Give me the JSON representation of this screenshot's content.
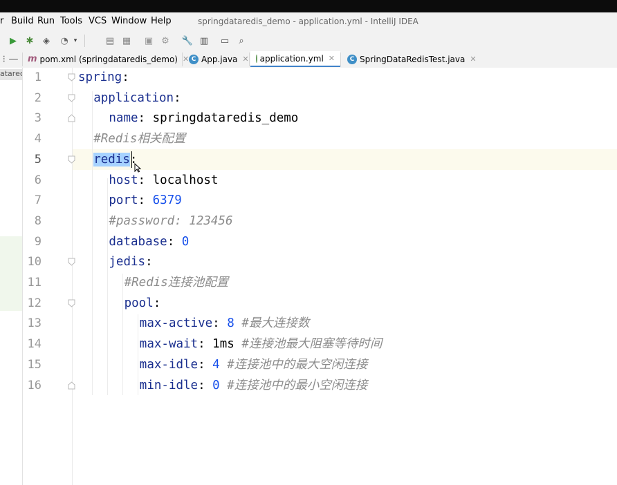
{
  "window": {
    "title": "springdataredis_demo - application.yml - IntelliJ IDEA"
  },
  "menu": [
    "r",
    "Build",
    "Run",
    "Tools",
    "VCS",
    "Window",
    "Help"
  ],
  "toolbar": {
    "icons": [
      "run-icon",
      "debug-icon",
      "coverage-icon",
      "profile-icon",
      "dropdown-icon",
      "build-icon",
      "project-structure-icon",
      "sdk-icon",
      "plugin-icon",
      "settings-wrench-icon",
      "structure-icon",
      "terminal-icon",
      "search-icon"
    ]
  },
  "tabs": [
    {
      "label": "pom.xml (springdataredis_demo)",
      "icon": "maven-icon",
      "icon_text": "m",
      "active": false
    },
    {
      "label": "App.java",
      "icon": "java-class-icon",
      "icon_text": "C",
      "active": false
    },
    {
      "label": "application.yml",
      "icon": "yaml-icon",
      "icon_text": "",
      "active": true
    },
    {
      "label": "SpringDataRedisTest.java",
      "icon": "java-class-icon",
      "icon_text": "C",
      "active": false
    }
  ],
  "side_label": "atarec",
  "editor": {
    "current_line": 5,
    "lines": [
      {
        "no": "1",
        "indent": 0,
        "parts": [
          {
            "t": "k",
            "s": "spring"
          },
          {
            "t": "v",
            "s": ":"
          }
        ]
      },
      {
        "no": "2",
        "indent": 1,
        "parts": [
          {
            "t": "k",
            "s": "application"
          },
          {
            "t": "v",
            "s": ":"
          }
        ]
      },
      {
        "no": "3",
        "indent": 2,
        "parts": [
          {
            "t": "k",
            "s": "name"
          },
          {
            "t": "v",
            "s": ": springdataredis_demo"
          }
        ]
      },
      {
        "no": "4",
        "indent": 1,
        "parts": [
          {
            "t": "c",
            "s": "#Redis相关配置"
          }
        ]
      },
      {
        "no": "5",
        "indent": 1,
        "parts": [
          {
            "t": "hl",
            "s": "redis"
          },
          {
            "t": "v",
            "s": ":"
          }
        ]
      },
      {
        "no": "6",
        "indent": 2,
        "parts": [
          {
            "t": "k",
            "s": "host"
          },
          {
            "t": "v",
            "s": ": localhost"
          }
        ]
      },
      {
        "no": "7",
        "indent": 2,
        "parts": [
          {
            "t": "k",
            "s": "port"
          },
          {
            "t": "v",
            "s": ": "
          },
          {
            "t": "n",
            "s": "6379"
          }
        ]
      },
      {
        "no": "8",
        "indent": 2,
        "parts": [
          {
            "t": "c",
            "s": "#password: 123456"
          }
        ]
      },
      {
        "no": "9",
        "indent": 2,
        "parts": [
          {
            "t": "k",
            "s": "database"
          },
          {
            "t": "v",
            "s": ": "
          },
          {
            "t": "n",
            "s": "0"
          }
        ]
      },
      {
        "no": "10",
        "indent": 2,
        "parts": [
          {
            "t": "k",
            "s": "jedis"
          },
          {
            "t": "v",
            "s": ":"
          }
        ]
      },
      {
        "no": "11",
        "indent": 3,
        "parts": [
          {
            "t": "c",
            "s": "#Redis连接池配置"
          }
        ]
      },
      {
        "no": "12",
        "indent": 3,
        "parts": [
          {
            "t": "k",
            "s": "pool"
          },
          {
            "t": "v",
            "s": ":"
          }
        ]
      },
      {
        "no": "13",
        "indent": 4,
        "parts": [
          {
            "t": "k",
            "s": "max-active"
          },
          {
            "t": "v",
            "s": ": "
          },
          {
            "t": "n",
            "s": "8"
          },
          {
            "t": "v",
            "s": " "
          },
          {
            "t": "c",
            "s": "#最大连接数"
          }
        ]
      },
      {
        "no": "14",
        "indent": 4,
        "parts": [
          {
            "t": "k",
            "s": "max-wait"
          },
          {
            "t": "v",
            "s": ": 1ms "
          },
          {
            "t": "c",
            "s": "#连接池最大阻塞等待时间"
          }
        ]
      },
      {
        "no": "15",
        "indent": 4,
        "parts": [
          {
            "t": "k",
            "s": "max-idle"
          },
          {
            "t": "v",
            "s": ": "
          },
          {
            "t": "n",
            "s": "4"
          },
          {
            "t": "v",
            "s": " "
          },
          {
            "t": "c",
            "s": "#连接池中的最大空闲连接"
          }
        ]
      },
      {
        "no": "16",
        "indent": 4,
        "parts": [
          {
            "t": "k",
            "s": "min-idle"
          },
          {
            "t": "v",
            "s": ": "
          },
          {
            "t": "n",
            "s": "0"
          },
          {
            "t": "v",
            "s": " "
          },
          {
            "t": "c",
            "s": "#连接池中的最小空闲连接"
          }
        ]
      }
    ]
  }
}
